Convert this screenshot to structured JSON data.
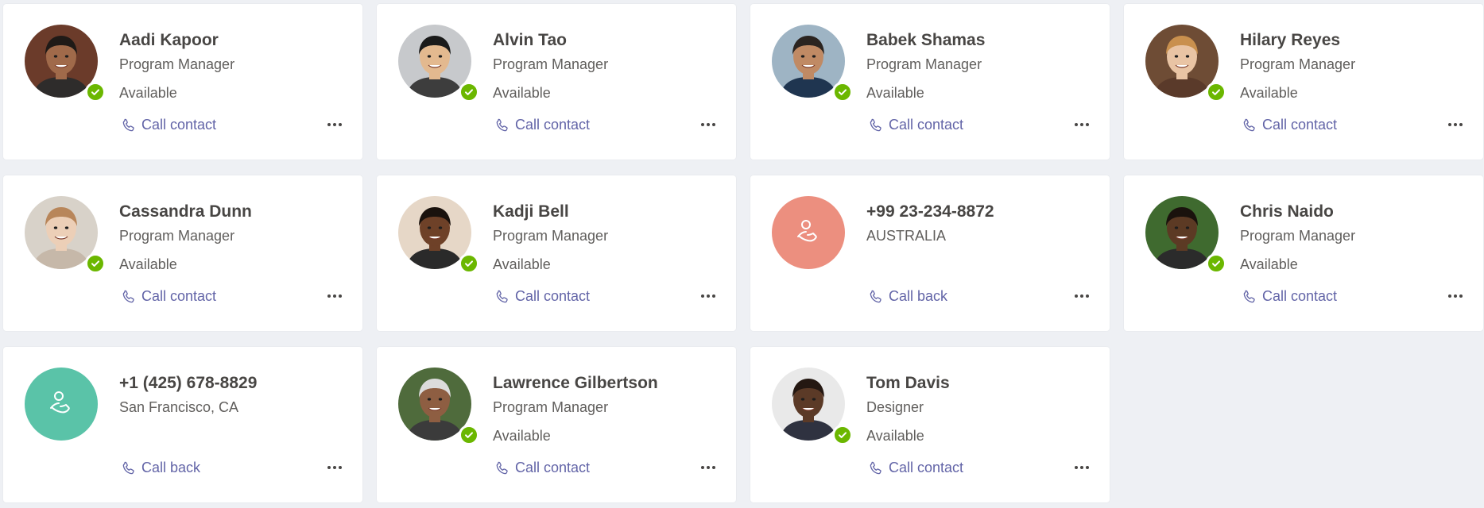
{
  "contacts": [
    {
      "name": "Aadi Kapoor",
      "subtitle": "Program Manager",
      "status": "Available",
      "action": "Call contact",
      "type": "person",
      "skin": "#a06a4a",
      "hair": "#1f1a17",
      "bg": "#6b3b2a",
      "shirt": "#2e2c2b"
    },
    {
      "name": "Alvin Tao",
      "subtitle": "Program Manager",
      "status": "Available",
      "action": "Call contact",
      "type": "person",
      "skin": "#e3b98f",
      "hair": "#1a1a1a",
      "bg": "#c7c9cc",
      "shirt": "#3d3d3d"
    },
    {
      "name": "Babek Shamas",
      "subtitle": "Program Manager",
      "status": "Available",
      "action": "Call contact",
      "type": "person",
      "skin": "#c08a64",
      "hair": "#2b2420",
      "bg": "#9eb4c4",
      "shirt": "#1f3550"
    },
    {
      "name": "Hilary Reyes",
      "subtitle": "Program Manager",
      "status": "Available",
      "action": "Call contact",
      "type": "person",
      "skin": "#e9c4a4",
      "hair": "#c9904e",
      "bg": "#6e4c35",
      "shirt": "#5a3a2a"
    },
    {
      "name": "Cassandra Dunn",
      "subtitle": "Program Manager",
      "status": "Available",
      "action": "Call contact",
      "type": "person",
      "skin": "#eccfb7",
      "hair": "#b8865a",
      "bg": "#d8d2c9",
      "shirt": "#c6b8a9"
    },
    {
      "name": "Kadji Bell",
      "subtitle": "Program Manager",
      "status": "Available",
      "action": "Call contact",
      "type": "person",
      "skin": "#6e4128",
      "hair": "#1a120d",
      "bg": "#e6d7c7",
      "shirt": "#2a2a2a"
    },
    {
      "name": "+99 23-234-8872",
      "subtitle": "AUSTRALIA",
      "status": "",
      "action": "Call back",
      "type": "phone",
      "color": "#ec8f7f"
    },
    {
      "name": "Chris Naido",
      "subtitle": "Program Manager",
      "status": "Available",
      "action": "Call contact",
      "type": "person",
      "skin": "#5c3a24",
      "hair": "#1a120d",
      "bg": "#3f6a2f",
      "shirt": "#2b2b2b"
    },
    {
      "name": "+1 (425) 678-8829",
      "subtitle": "San Francisco, CA",
      "status": "",
      "action": "Call back",
      "type": "phone",
      "color": "#5ac3a8"
    },
    {
      "name": "Lawrence Gilbertson",
      "subtitle": "Program Manager",
      "status": "Available",
      "action": "Call contact",
      "type": "person",
      "skin": "#8e5e42",
      "hair": "#dcdcdc",
      "bg": "#4f6b3c",
      "shirt": "#3b3b3b"
    },
    {
      "name": "Tom Davis",
      "subtitle": "Designer",
      "status": "Available",
      "action": "Call contact",
      "type": "person",
      "skin": "#5b3a27",
      "hair": "#241812",
      "bg": "#e9e9e9",
      "shirt": "#2f3240"
    }
  ],
  "colors": {
    "accent": "#6264a7",
    "presence_available": "#6bb700",
    "name_text": "#484644",
    "secondary_text": "#605e5c"
  },
  "icons": {
    "presence": "checkmark-icon",
    "call": "phone-icon",
    "more": "more-options-icon",
    "avatar_placeholder": "phone-person-icon"
  }
}
